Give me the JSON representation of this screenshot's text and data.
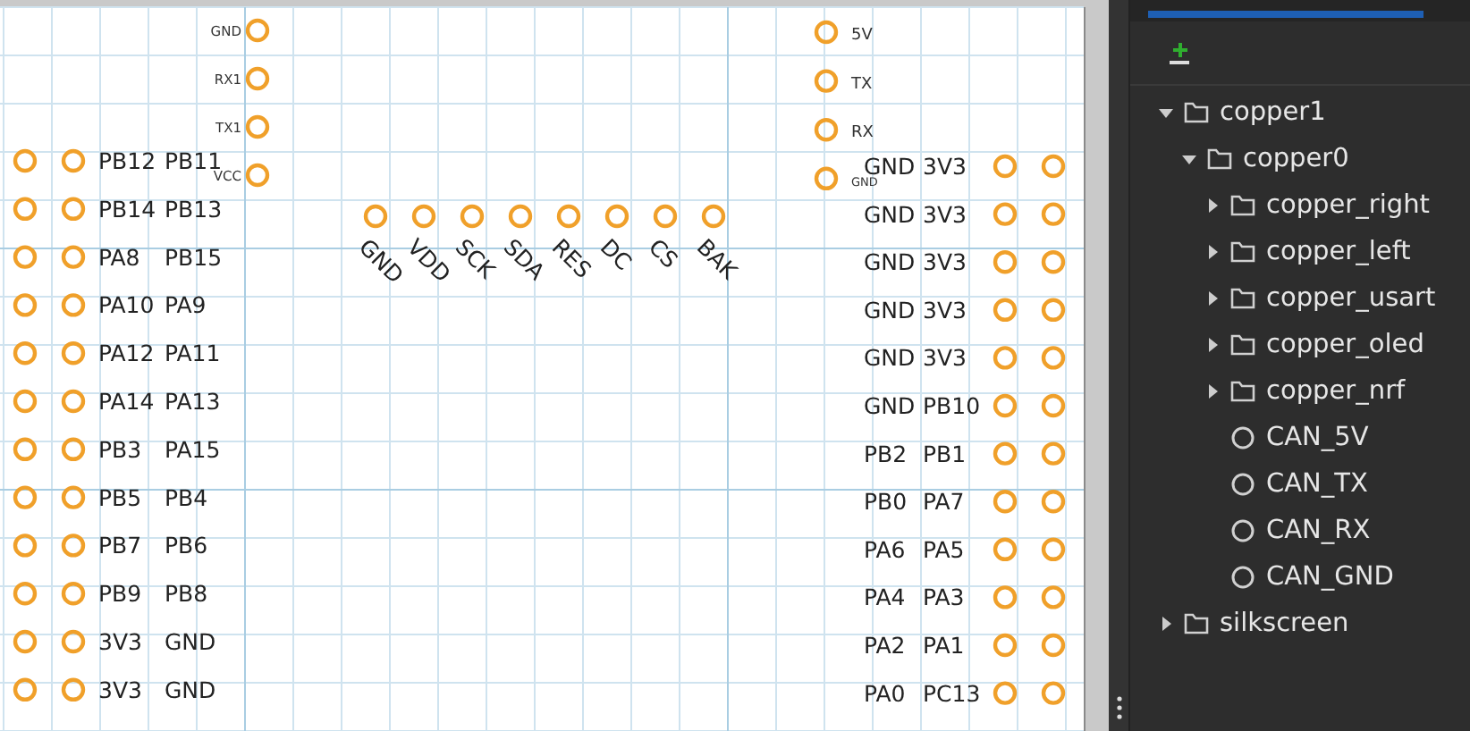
{
  "canvas": {
    "top_header_pins": [
      "GND",
      "RX1",
      "TX1",
      "VCC"
    ],
    "usart_pins": [
      "5V",
      "TX",
      "RX",
      "GND"
    ],
    "oled_pins": [
      "GND",
      "VDD",
      "SCK",
      "SDA",
      "RES",
      "DC",
      "CS",
      "BAK"
    ],
    "left_connector_rows": [
      [
        "PB12",
        "PB11"
      ],
      [
        "PB14",
        "PB13"
      ],
      [
        "PA8",
        "PB15"
      ],
      [
        "PA10",
        "PA9"
      ],
      [
        "PA12",
        "PA11"
      ],
      [
        "PA14",
        "PA13"
      ],
      [
        "PB3",
        "PA15"
      ],
      [
        "PB5",
        "PB4"
      ],
      [
        "PB7",
        "PB6"
      ],
      [
        "PB9",
        "PB8"
      ],
      [
        "3V3",
        "GND"
      ],
      [
        "3V3",
        "GND"
      ]
    ],
    "right_connector_rows": [
      [
        "GND",
        "3V3"
      ],
      [
        "GND",
        "3V3"
      ],
      [
        "GND",
        "3V3"
      ],
      [
        "GND",
        "3V3"
      ],
      [
        "GND",
        "3V3"
      ],
      [
        "GND",
        "PB10"
      ],
      [
        "PB2",
        "PB1"
      ],
      [
        "PB0",
        "PA7"
      ],
      [
        "PA6",
        "PA5"
      ],
      [
        "PA4",
        "PA3"
      ],
      [
        "PA2",
        "PA1"
      ],
      [
        "PA0",
        "PC13"
      ]
    ]
  },
  "layers_panel": {
    "tree": [
      {
        "label": "copper1",
        "kind": "folder",
        "expanded": true,
        "children": [
          {
            "label": "copper0",
            "kind": "folder",
            "expanded": true,
            "children": [
              {
                "label": "copper_right",
                "kind": "folder",
                "expanded": false
              },
              {
                "label": "copper_left",
                "kind": "folder",
                "expanded": false
              },
              {
                "label": "copper_usart",
                "kind": "folder",
                "expanded": false
              },
              {
                "label": "copper_oled",
                "kind": "folder",
                "expanded": false
              },
              {
                "label": "copper_nrf",
                "kind": "folder",
                "expanded": false
              },
              {
                "label": "CAN_5V",
                "kind": "pad"
              },
              {
                "label": "CAN_TX",
                "kind": "pad"
              },
              {
                "label": "CAN_RX",
                "kind": "pad"
              },
              {
                "label": "CAN_GND",
                "kind": "pad"
              }
            ]
          }
        ]
      },
      {
        "label": "silkscreen",
        "kind": "folder",
        "expanded": false
      }
    ]
  }
}
